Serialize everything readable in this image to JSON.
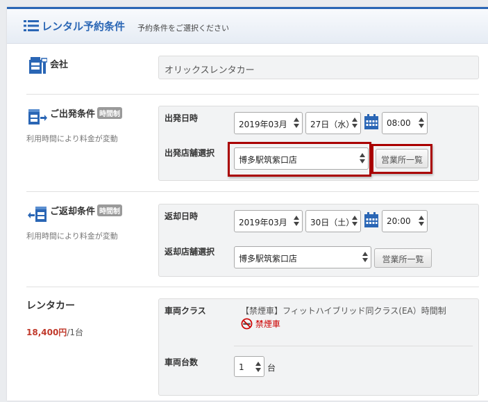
{
  "header": {
    "title": "レンタル予約条件",
    "subtitle": "予約条件をご選択ください"
  },
  "company": {
    "title": "会社",
    "value": "オリックスレンタカー"
  },
  "departure": {
    "title": "ご出発条件",
    "badge": "時間制",
    "note": "利用時間により料金が変動",
    "datetime_label": "出発日時",
    "month": "2019年03月",
    "day": "27日（水）",
    "time": "08:00",
    "store_label": "出発店舗選択",
    "store": "博多駅筑紫口店",
    "store_list_button": "営業所一覧"
  },
  "return": {
    "title": "ご返却条件",
    "badge": "時間制",
    "note": "利用時間により料金が変動",
    "datetime_label": "返却日時",
    "month": "2019年03月",
    "day": "30日（土）",
    "time": "20:00",
    "store_label": "返却店舗選択",
    "store": "博多駅筑紫口店",
    "store_list_button": "営業所一覧"
  },
  "rental": {
    "title": "レンタカー",
    "price": "18,400円",
    "price_unit": "/1台",
    "class_label": "車両クラス",
    "class_value": "【禁煙車】フィットハイブリッド同クラス(EA）時間制",
    "non_smoking": "禁煙車",
    "count_label": "車両台数",
    "count": "1",
    "count_unit": "台"
  },
  "colors": {
    "accent": "#2a66b5",
    "price": "#c0392b",
    "highlight": "#aa0000",
    "non_smoking": "#cc0000"
  }
}
